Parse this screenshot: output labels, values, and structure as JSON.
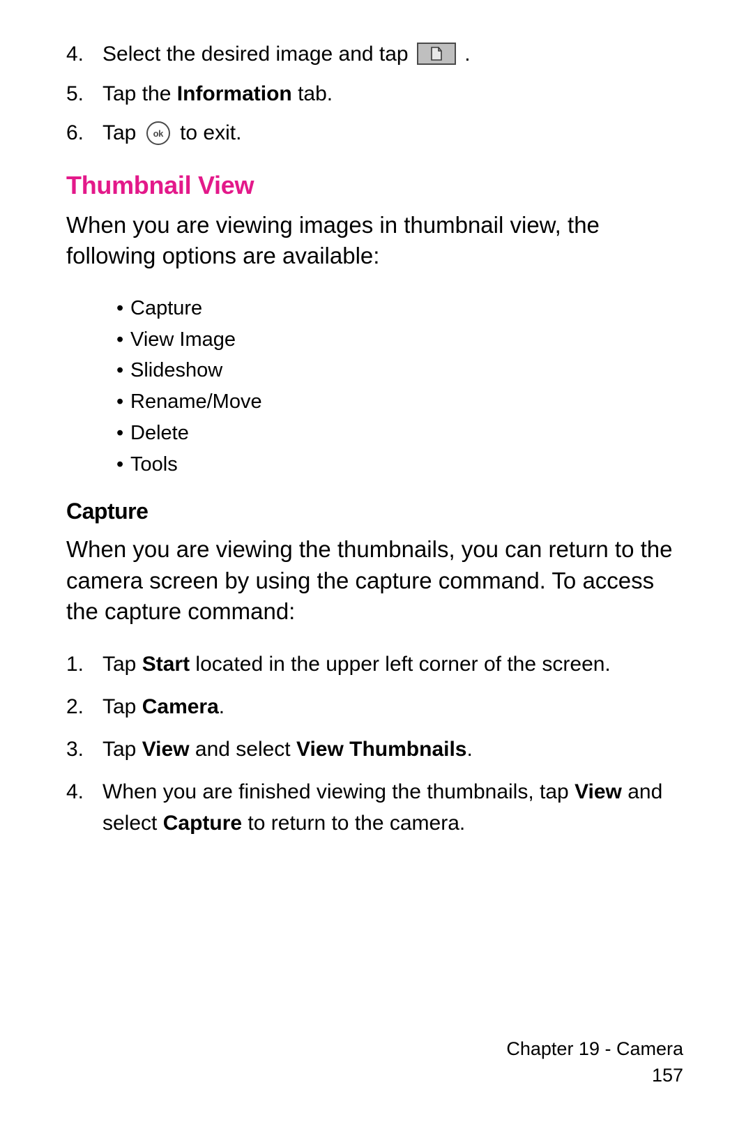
{
  "top_steps": [
    {
      "num": "4.",
      "pre": "Select the desired image and tap ",
      "post": "."
    },
    {
      "num": "5.",
      "pre": "Tap the ",
      "bold": "Information",
      "post": " tab."
    },
    {
      "num": "6.",
      "pre": "Tap ",
      "post": " to exit."
    }
  ],
  "ok_label": "ok",
  "section_title": "Thumbnail View",
  "thumb_intro": "When you are viewing images in thumbnail view, the following options are available:",
  "thumb_options": [
    "Capture",
    "View Image",
    "Slideshow",
    "Rename/Move",
    "Delete",
    "Tools"
  ],
  "sub_title": "Capture",
  "capture_intro": "When you are viewing the thumbnails, you can return to the camera screen by using the capture command. To access the capture command:",
  "capture_steps": {
    "s1": {
      "num": "1.",
      "t1": "Tap ",
      "b1": "Start",
      "t2": " located in the upper left corner of the screen."
    },
    "s2": {
      "num": "2.",
      "t1": "Tap ",
      "b1": "Camera",
      "t2": "."
    },
    "s3": {
      "num": "3.",
      "t1": "Tap ",
      "b1": "View",
      "t2": " and select ",
      "b2": "View Thumbnails",
      "t3": "."
    },
    "s4": {
      "num": "4.",
      "t1": "When you are finished viewing the thumbnails, tap ",
      "b1": "View",
      "t2": " and select ",
      "b2": "Capture",
      "t3": " to return to the camera."
    }
  },
  "footer": {
    "chapter": "Chapter 19 - Camera",
    "page": "157"
  }
}
